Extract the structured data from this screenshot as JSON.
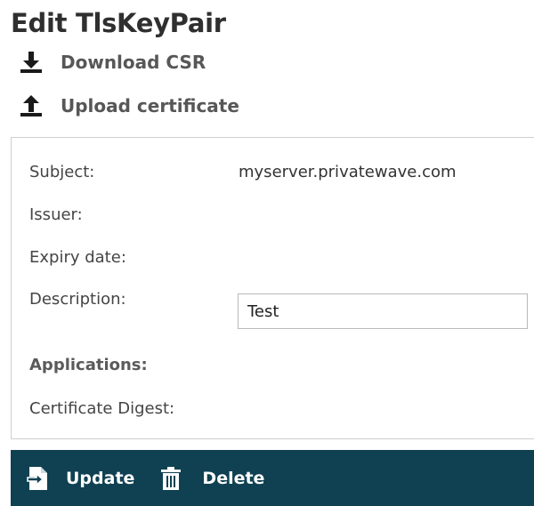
{
  "page": {
    "title": "Edit TlsKeyPair"
  },
  "actions": {
    "download_csr": "Download CSR",
    "upload_certificate": "Upload certificate"
  },
  "form": {
    "subject_label": "Subject:",
    "subject_value": "myserver.privatewave.com",
    "issuer_label": "Issuer:",
    "issuer_value": "",
    "expiry_label": "Expiry date:",
    "expiry_value": "",
    "description_label": "Description:",
    "description_value": "Test",
    "applications_label": "Applications:",
    "digest_label": "Certificate Digest:",
    "digest_value": ""
  },
  "toolbar": {
    "update_label": "Update",
    "delete_label": "Delete"
  },
  "colors": {
    "toolbar_bg": "#0f4152",
    "title_text": "#2f2f2f",
    "link_text": "#575757"
  },
  "icons": {
    "download": "download-icon",
    "upload": "upload-icon",
    "update": "update-icon",
    "delete": "trash-icon"
  }
}
